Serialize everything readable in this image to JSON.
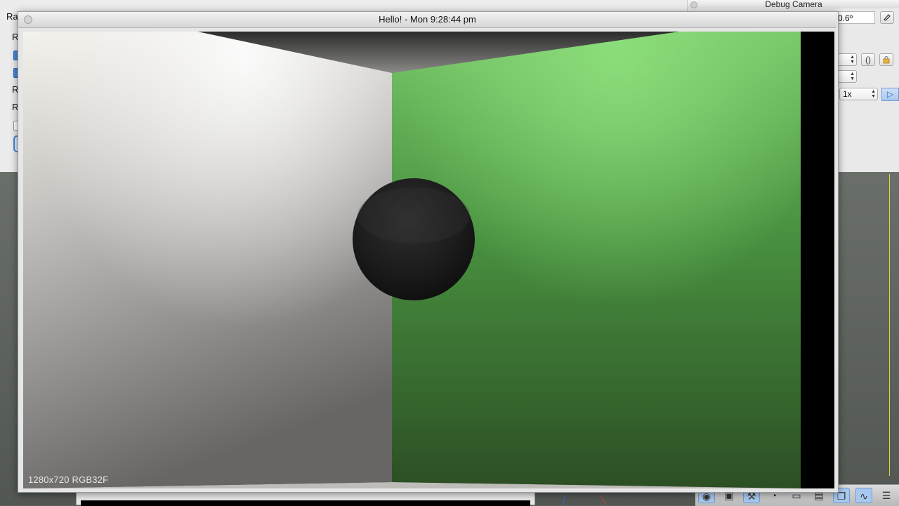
{
  "window": {
    "title": "Hello! - Mon 9:28:44 pm"
  },
  "viewport": {
    "status": "1280x720 RGB32F"
  },
  "back_panel": {
    "labels": [
      "Ra",
      "R",
      "R",
      "R"
    ]
  },
  "debug_camera": {
    "title": "Debug Camera",
    "angle_value": "0.6º",
    "speed_value": "1x",
    "icons": [
      "reset-icon",
      "braces-icon",
      "lock-icon",
      "play-icon"
    ]
  },
  "dock": {
    "icons": [
      "camera-icon",
      "image-icon",
      "wrench-icon",
      "gauge-icon",
      "blank-icon",
      "terminal-icon",
      "windows-icon",
      "monitor-icon",
      "document-icon"
    ]
  },
  "scene": {
    "colors": {
      "left_wall": "#c9c8c4",
      "right_wall": "#4f9a46",
      "ceiling": "#3a3a3a",
      "sphere": "#1d1d1d"
    }
  }
}
